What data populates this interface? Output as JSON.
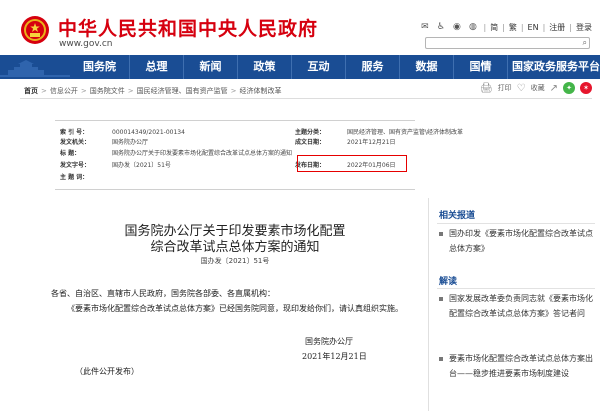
{
  "header": {
    "site_title": "中华人民共和国中央人民政府",
    "site_url": "www.gov.cn",
    "util": {
      "simplified": "简",
      "traditional": "繁",
      "english": "EN",
      "register": "注册",
      "login": "登录"
    }
  },
  "nav": {
    "items": [
      "国务院",
      "总理",
      "新闻",
      "政策",
      "互动",
      "服务",
      "数据",
      "国情",
      "国家政务服务平台"
    ]
  },
  "breadcrumb": {
    "home": "首页",
    "items": [
      "信息公开",
      "国务院文件",
      "国民经济管理、国有资产监管",
      "经济体制改革"
    ]
  },
  "tools": {
    "print_icon": "🖨",
    "print": "打印",
    "favorite_icon": "♡",
    "favorite": "收藏",
    "share_icon": "↗"
  },
  "info": {
    "index_label": "索  引  号：",
    "index_value": "000014349/2021-00134",
    "subject_label": "主题分类：",
    "subject_value": "国民经济管理、国有资产监管\\经济体制改革",
    "issuer_label": "发文机关：",
    "issuer_value": "国务院办公厅",
    "created_label": "成文日期：",
    "created_value": "2021年12月21日",
    "title_label": "标      题：",
    "title_value": "国务院办公厅关于印发要素市场化配置综合改革试点总体方案的通知",
    "number_label": "发文字号：",
    "number_value": "国办发〔2021〕51号",
    "published_label": "发布日期：",
    "published_value": "2022年01月06日",
    "keywords_label": "主  题  词："
  },
  "article": {
    "title_line1": "国务院办公厅关于印发要素市场化配置",
    "title_line2": "综合改革试点总体方案的通知",
    "doc_number": "国办发〔2021〕51号",
    "salutation": "各省、自治区、直辖市人民政府，国务院各部委、各直属机构：",
    "paragraph": "《要素市场化配置综合改革试点总体方案》已经国务院同意，现印发给你们，请认真组织实施。",
    "signature": "国务院办公厅",
    "date": "2021年12月21日",
    "note": "（此件公开发布）"
  },
  "sidebar": {
    "related_title": "相关报道",
    "related_items": [
      "国办印发《要素市场化配置综合改革试点总体方案》"
    ],
    "analysis_title": "解读",
    "analysis_items": [
      "国家发展改革委负责同志就《要素市场化配置综合改革试点总体方案》答记者问",
      "要素市场化配置综合改革试点总体方案出台——稳步推进要素市场制度建设"
    ]
  },
  "colors": {
    "brand_red": "#d6000f",
    "nav_blue": "#1a4d94",
    "highlight_red": "#e60000"
  }
}
